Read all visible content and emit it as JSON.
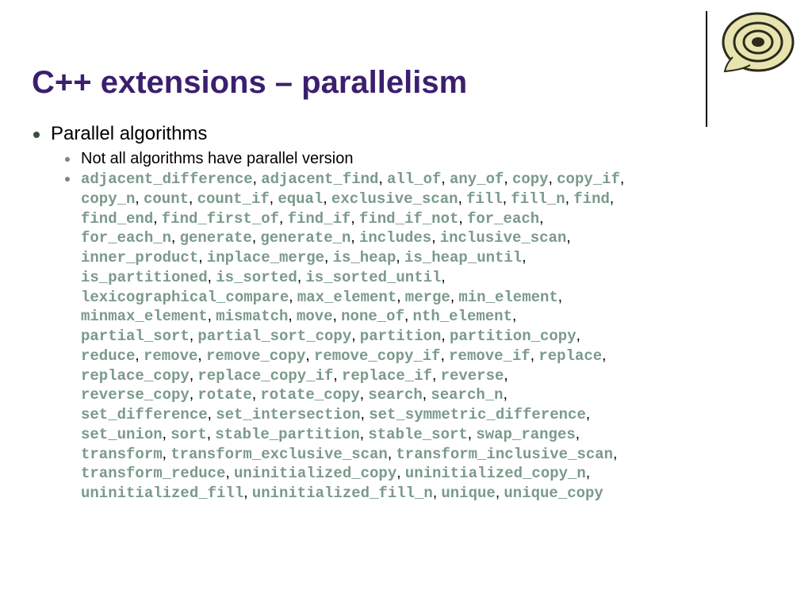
{
  "title": "C++ extensions – parallelism",
  "bullet1": "Parallel algorithms",
  "bullet1_1": "Not all algorithms have parallel version",
  "algorithms": [
    "adjacent_difference",
    "adjacent_find",
    "all_of",
    "any_of",
    "copy",
    "copy_if",
    "copy_n",
    "count",
    "count_if",
    "equal",
    "exclusive_scan",
    "fill",
    "fill_n",
    "find",
    "find_end",
    "find_first_of",
    "find_if",
    "find_if_not",
    "for_each",
    "for_each_n",
    "generate",
    "generate_n",
    "includes",
    "inclusive_scan",
    "inner_product",
    "inplace_merge",
    "is_heap",
    "is_heap_until",
    "is_partitioned",
    "is_sorted",
    "is_sorted_until",
    "lexicographical_compare",
    "max_element",
    "merge",
    "min_element",
    "minmax_element",
    "mismatch",
    "move",
    "none_of",
    "nth_element",
    "partial_sort",
    "partial_sort_copy",
    "partition",
    "partition_copy",
    "reduce",
    "remove",
    "remove_copy",
    "remove_copy_if",
    "remove_if",
    "replace",
    "replace_copy",
    "replace_copy_if",
    "replace_if",
    "reverse",
    "reverse_copy",
    "rotate",
    "rotate_copy",
    "search",
    "search_n",
    "set_difference",
    "set_intersection",
    "set_symmetric_difference",
    "set_union",
    "sort",
    "stable_partition",
    "stable_sort",
    "swap_ranges",
    "transform",
    "transform_exclusive_scan",
    "transform_inclusive_scan",
    "transform_reduce",
    "uninitialized_copy",
    "uninitialized_copy_n",
    "uninitialized_fill",
    "uninitialized_fill_n",
    "unique",
    "unique_copy"
  ],
  "line_breaks_after": [
    5,
    13,
    18,
    23,
    27,
    30,
    34,
    39,
    43,
    49,
    53,
    58,
    61,
    66,
    69,
    72
  ]
}
